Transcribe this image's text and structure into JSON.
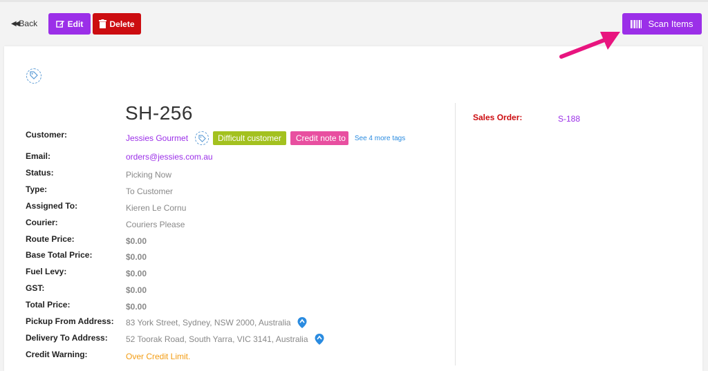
{
  "toolbar": {
    "back_label": "Back",
    "edit_label": "Edit",
    "delete_label": "Delete",
    "scan_label": "Scan Items"
  },
  "shipment": {
    "title": "SH-256",
    "fields": {
      "customer": {
        "label": "Customer:",
        "value": "Jessies Gourmet"
      },
      "email": {
        "label": "Email:",
        "value": "orders@jessies.com.au"
      },
      "status": {
        "label": "Status:",
        "value": "Picking Now"
      },
      "type": {
        "label": "Type:",
        "value": "To Customer"
      },
      "assigned": {
        "label": "Assigned To:",
        "value": "Kieren Le Cornu"
      },
      "courier": {
        "label": "Courier:",
        "value": "Couriers Please"
      },
      "route_price": {
        "label": "Route Price:",
        "value": "$0.00"
      },
      "base_total": {
        "label": "Base Total Price:",
        "value": "$0.00"
      },
      "fuel_levy": {
        "label": "Fuel Levy:",
        "value": "$0.00"
      },
      "gst": {
        "label": "GST:",
        "value": "$0.00"
      },
      "total_price": {
        "label": "Total Price:",
        "value": "$0.00"
      },
      "pickup": {
        "label": "Pickup From Address:",
        "value": "83 York Street, Sydney, NSW 2000, Australia"
      },
      "delivery": {
        "label": "Delivery To Address:",
        "value": "52 Toorak Road, South Yarra, VIC 3141, Australia"
      },
      "credit_warning": {
        "label": "Credit Warning:",
        "value": "Over Credit Limit."
      }
    },
    "tags": {
      "tag1": "Difficult customer",
      "tag2": "Credit note to",
      "more": "See 4 more tags"
    },
    "sales_order": {
      "label": "Sales Order:",
      "value": "S-188"
    }
  },
  "colors": {
    "accent": "#9b2fe8",
    "danger": "#cc0c10",
    "annotation_arrow": "#e8157f",
    "tag_green": "#a3c11f",
    "tag_pink": "#e84fa0",
    "link_blue": "#2a8be0",
    "warning": "#f39c12"
  },
  "icons": {
    "back": "double-left-arrow-icon",
    "edit": "pencil-square-icon",
    "delete": "trash-icon",
    "scan": "barcode-icon",
    "tag": "tag-icon",
    "map": "map-pin-icon"
  }
}
